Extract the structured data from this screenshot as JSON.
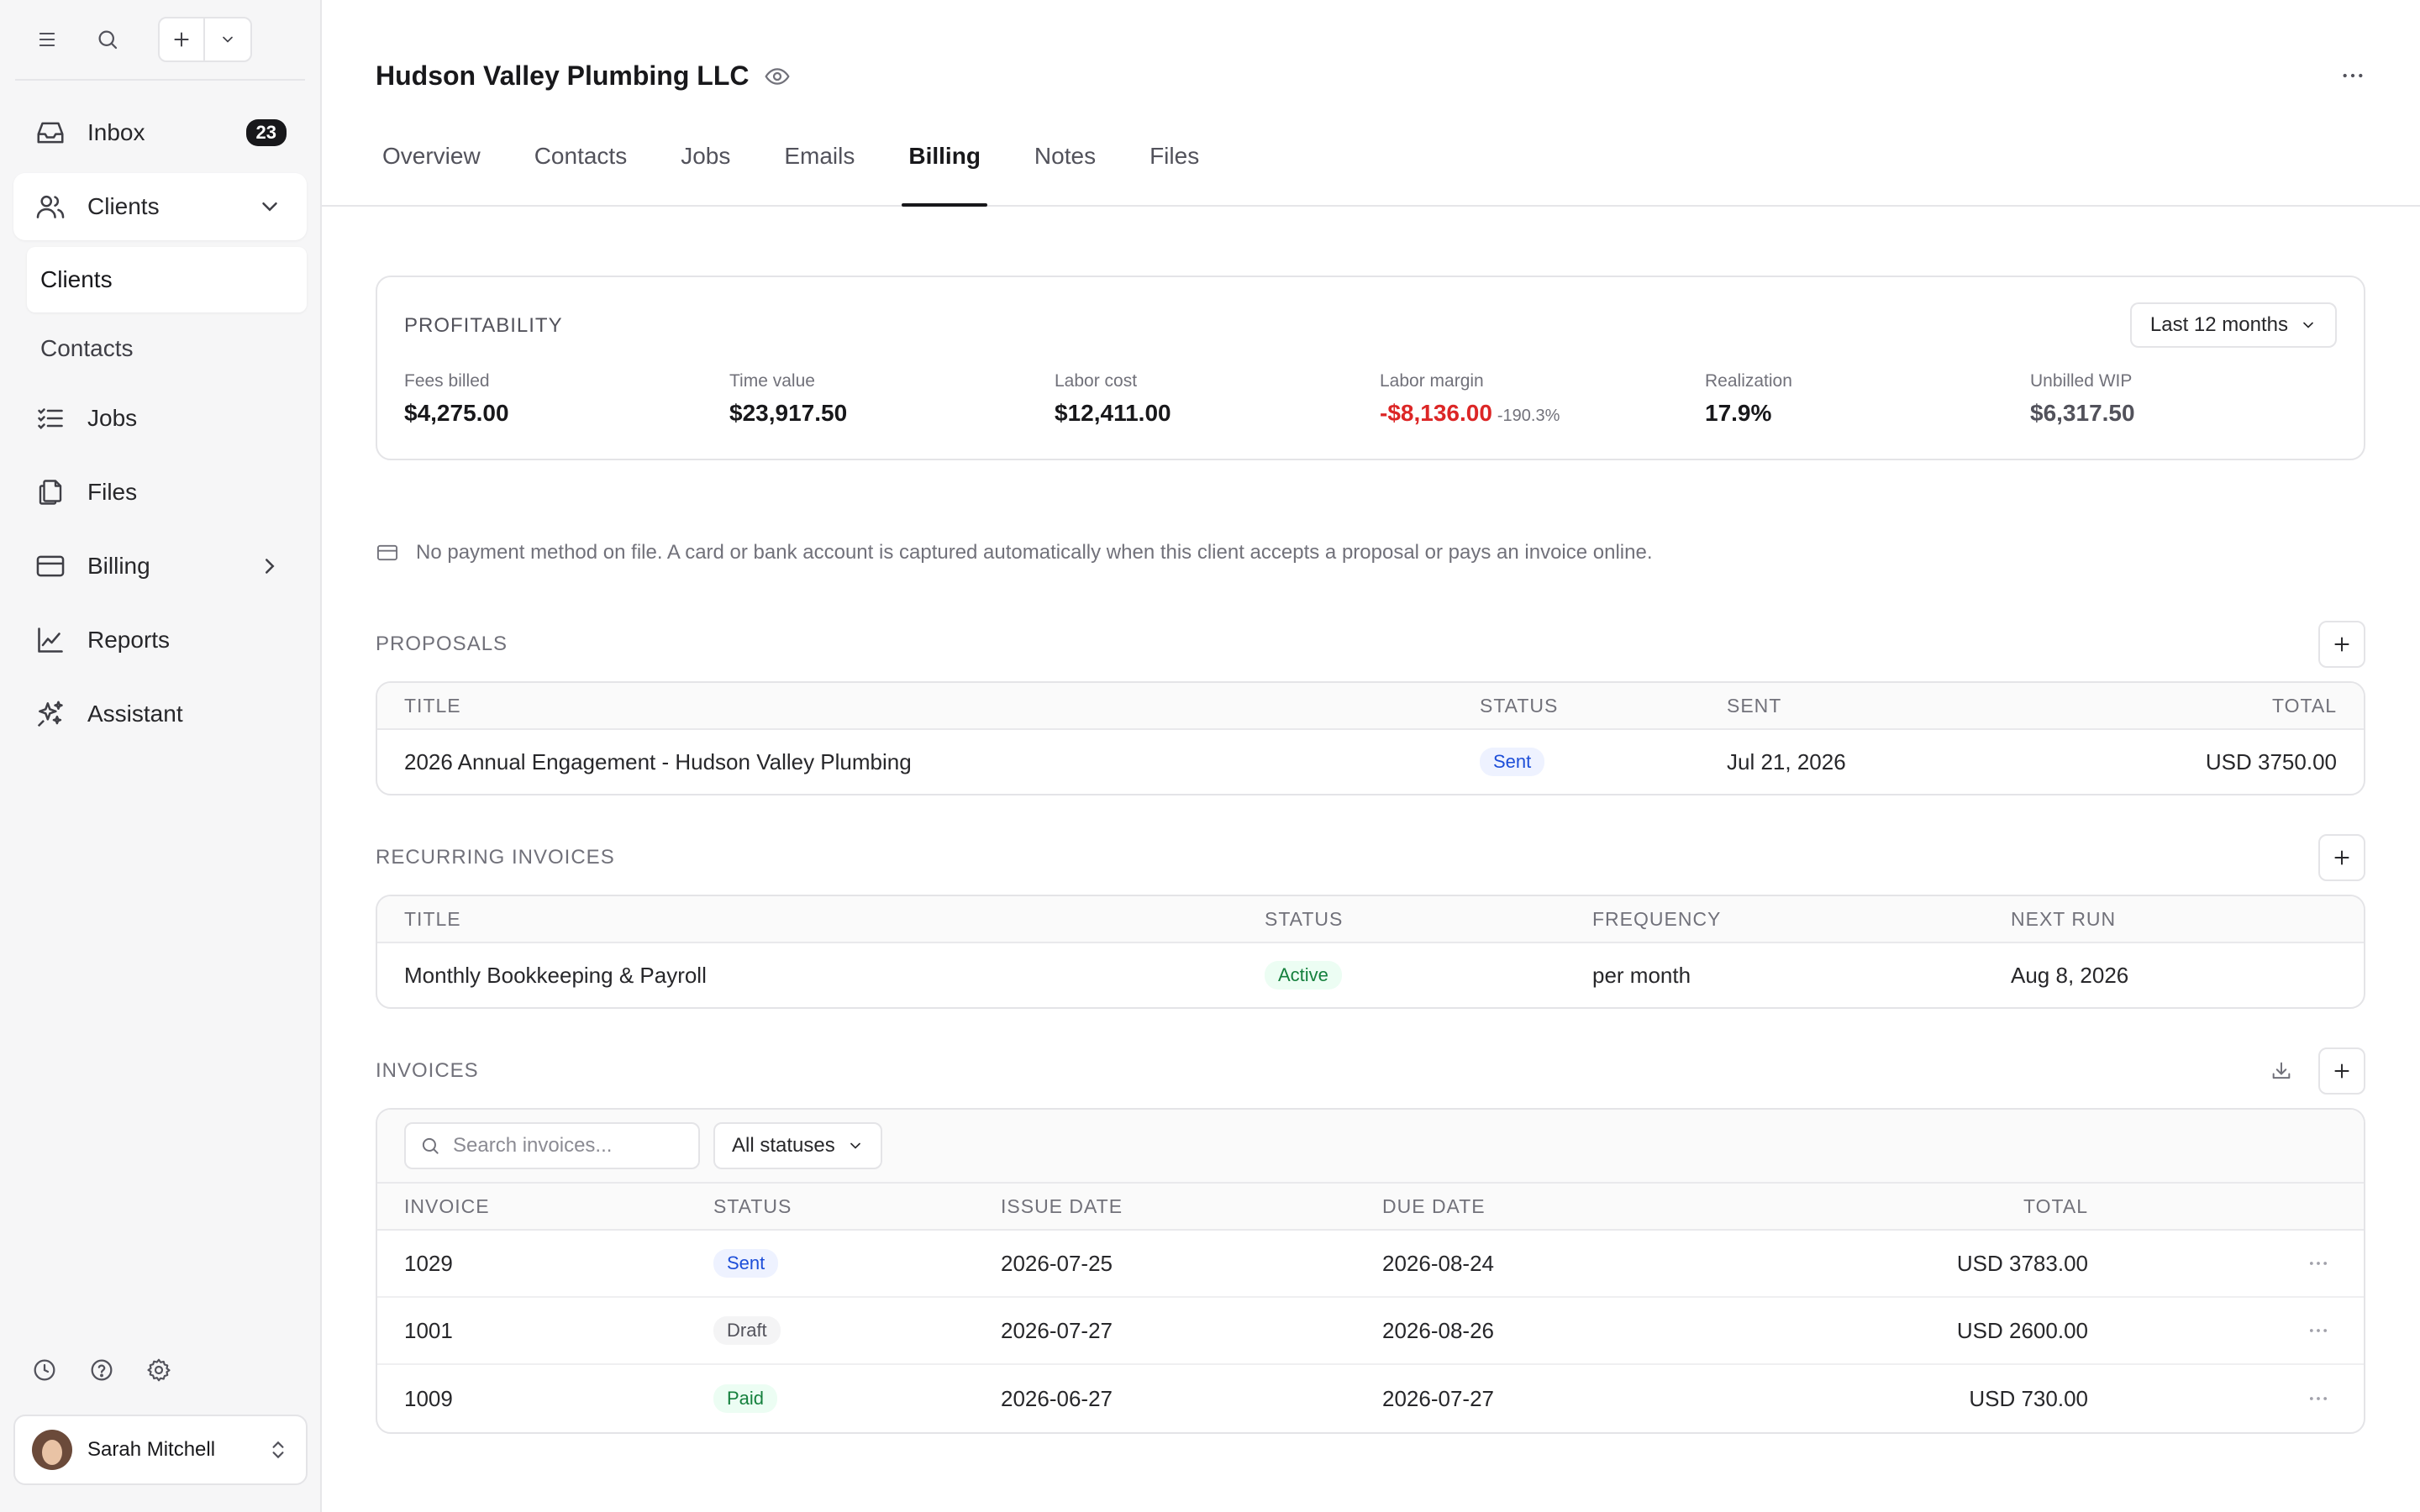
{
  "sidebar": {
    "nav": [
      {
        "label": "Inbox",
        "icon": "inbox-icon",
        "badge": "23"
      },
      {
        "label": "Clients",
        "icon": "users-icon"
      },
      {
        "label": "Jobs",
        "icon": "list-check-icon"
      },
      {
        "label": "Files",
        "icon": "files-icon"
      },
      {
        "label": "Billing",
        "icon": "credit-card-icon"
      },
      {
        "label": "Reports",
        "icon": "chart-line-icon"
      },
      {
        "label": "Assistant",
        "icon": "sparkles-icon"
      }
    ],
    "sub": [
      {
        "label": "Clients"
      },
      {
        "label": "Contacts"
      }
    ],
    "user": {
      "name": "Sarah Mitchell"
    }
  },
  "header": {
    "title": "Hudson Valley Plumbing LLC",
    "tabs": [
      "Overview",
      "Contacts",
      "Jobs",
      "Emails",
      "Billing",
      "Notes",
      "Files"
    ],
    "active_tab": "Billing"
  },
  "profitability": {
    "label": "PROFITABILITY",
    "period": "Last 12 months",
    "metrics": [
      {
        "label": "Fees billed",
        "value": "$4,275.00"
      },
      {
        "label": "Time value",
        "value": "$23,917.50"
      },
      {
        "label": "Labor cost",
        "value": "$12,411.00"
      },
      {
        "label": "Labor margin",
        "value": "-$8,136.00",
        "sub": "-190.3%"
      },
      {
        "label": "Realization",
        "value": "17.9%"
      },
      {
        "label": "Unbilled WIP",
        "value": "$6,317.50"
      }
    ]
  },
  "notice": "No payment method on file. A card or bank account is captured automatically when this client accepts a proposal or pays an invoice online.",
  "proposals": {
    "label": "PROPOSALS",
    "columns": [
      "TITLE",
      "STATUS",
      "SENT",
      "TOTAL"
    ],
    "rows": [
      {
        "title": "2026 Annual Engagement - Hudson Valley Plumbing",
        "status": "Sent",
        "sent": "Jul 21, 2026",
        "total": "USD 3750.00"
      }
    ]
  },
  "recurring": {
    "label": "RECURRING INVOICES",
    "columns": [
      "TITLE",
      "STATUS",
      "FREQUENCY",
      "NEXT RUN"
    ],
    "rows": [
      {
        "title": "Monthly Bookkeeping & Payroll",
        "status": "Active",
        "frequency": "per month",
        "next_run": "Aug 8, 2026"
      }
    ]
  },
  "invoices": {
    "label": "INVOICES",
    "search_placeholder": "Search invoices...",
    "filter": "All statuses",
    "columns": [
      "INVOICE",
      "STATUS",
      "ISSUE DATE",
      "DUE DATE",
      "TOTAL"
    ],
    "rows": [
      {
        "invoice": "1029",
        "status": "Sent",
        "issue": "2026-07-25",
        "due": "2026-08-24",
        "total": "USD 3783.00"
      },
      {
        "invoice": "1001",
        "status": "Draft",
        "issue": "2026-07-27",
        "due": "2026-08-26",
        "total": "USD 2600.00"
      },
      {
        "invoice": "1009",
        "status": "Paid",
        "issue": "2026-06-27",
        "due": "2026-07-27",
        "total": "USD 730.00"
      }
    ]
  },
  "colors": {
    "accent": "#18181b",
    "negative": "#dc2626",
    "sent": "#1d4ed8",
    "active": "#15803d"
  }
}
